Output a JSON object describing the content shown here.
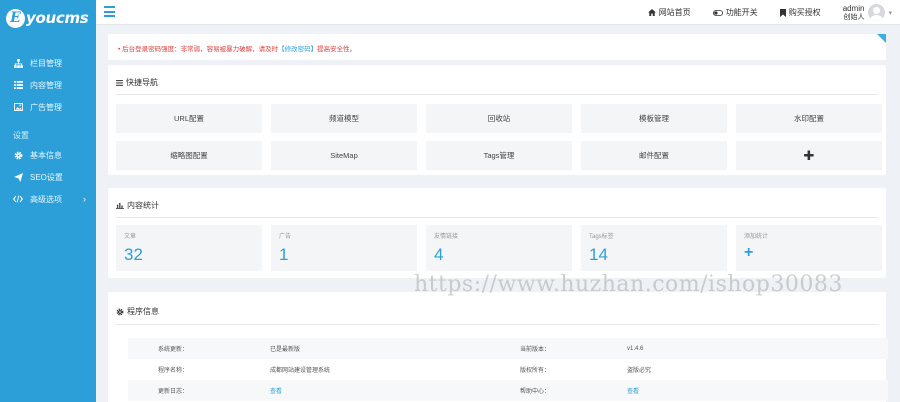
{
  "sidebar": {
    "logo_letter": "E",
    "logo_text": "youcms",
    "items_top": [
      {
        "label": "栏目管理",
        "icon": "sitemap-icon"
      },
      {
        "label": "内容管理",
        "icon": "list-icon"
      },
      {
        "label": "广告管理",
        "icon": "image-icon"
      }
    ],
    "section_label": "设置",
    "items_settings": [
      {
        "label": "基本信息",
        "icon": "gear-icon"
      },
      {
        "label": "SEO设置",
        "icon": "send-icon"
      },
      {
        "label": "高级选项",
        "icon": "code-icon"
      }
    ],
    "expand_arrow": "›"
  },
  "topbar": {
    "links": [
      {
        "label": "网站首页",
        "icon": "home-icon"
      },
      {
        "label": "功能开关",
        "icon": "toggle-icon"
      },
      {
        "label": "购买授权",
        "icon": "bookmark-icon"
      }
    ],
    "user_name": "admin",
    "user_role": "创始人",
    "caret": "▾"
  },
  "alert": {
    "text_before": "• 后台登录密码强度：非常弱，容易被暴力破解，请及时",
    "link_text": "【修改密码】",
    "text_after": "提高安全性。"
  },
  "quick_nav": {
    "title": "快捷导航",
    "buttons": [
      "URL配置",
      "频道模型",
      "回收站",
      "模板管理",
      "水印配置",
      "缩略图配置",
      "SiteMap",
      "Tags管理",
      "邮件配置"
    ],
    "add_button": "✚"
  },
  "stats": {
    "title": "内容统计",
    "items": [
      {
        "label": "文章",
        "value": "32"
      },
      {
        "label": "广告",
        "value": "1"
      },
      {
        "label": "友情链接",
        "value": "4"
      },
      {
        "label": "Tags标签",
        "value": "14"
      }
    ],
    "add_label": "添加统计",
    "add_value": "+"
  },
  "program_info": {
    "title": "程序信息",
    "rows": [
      {
        "k1": "系统更新：",
        "v1": "已是最新版",
        "k2": "当前版本：",
        "v2": "v1.4.6"
      },
      {
        "k1": "程序名称：",
        "v1": "成都网站建设管理系统",
        "k2": "版权所有：",
        "v2": "盗版必究"
      },
      {
        "k1": "更新日志：",
        "v1": "查看",
        "k2": "帮助中心：",
        "v2": "查看"
      }
    ]
  },
  "watermark": "https://www.huzhan.com/ishop30083",
  "colors": {
    "sidebar": "#2d9fd8",
    "accent": "#2d9fd8",
    "alert_text": "#e23c3c",
    "background": "#eef1f5"
  }
}
